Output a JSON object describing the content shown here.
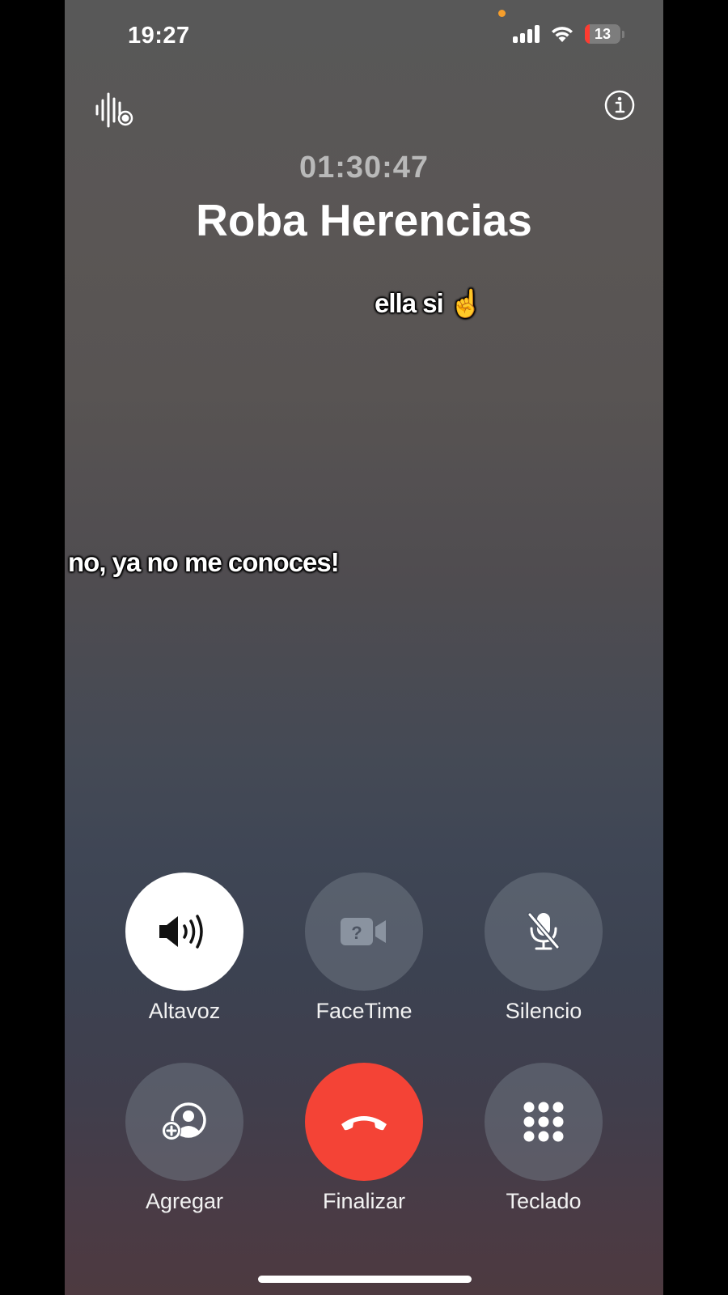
{
  "status_bar": {
    "time": "19:27",
    "battery_label": "13",
    "battery_level": 0.13,
    "battery_color": "#ff3b30",
    "privacy_dot_color": "#f59e2c"
  },
  "call": {
    "timer": "01:30:47",
    "contact_name": "Roba Herencias"
  },
  "captions": {
    "caption_1": "ella si ☝️",
    "caption_2": "no, ya no me conoces!"
  },
  "controls": {
    "speaker_label": "Altavoz",
    "facetime_label": "FaceTime",
    "mute_label": "Silencio",
    "add_label": "Agregar",
    "end_label": "Finalizar",
    "keypad_label": "Teclado"
  },
  "icons": {
    "audio": "audio-waveform-icon",
    "info": "info-icon",
    "speaker": "speaker-icon",
    "facetime": "video-camera-question-icon",
    "mute": "microphone-slash-icon",
    "add": "add-person-icon",
    "end": "phone-hangup-icon",
    "keypad": "keypad-icon"
  },
  "colors": {
    "end_call": "#f44336",
    "speaker_active": "#ffffff"
  }
}
